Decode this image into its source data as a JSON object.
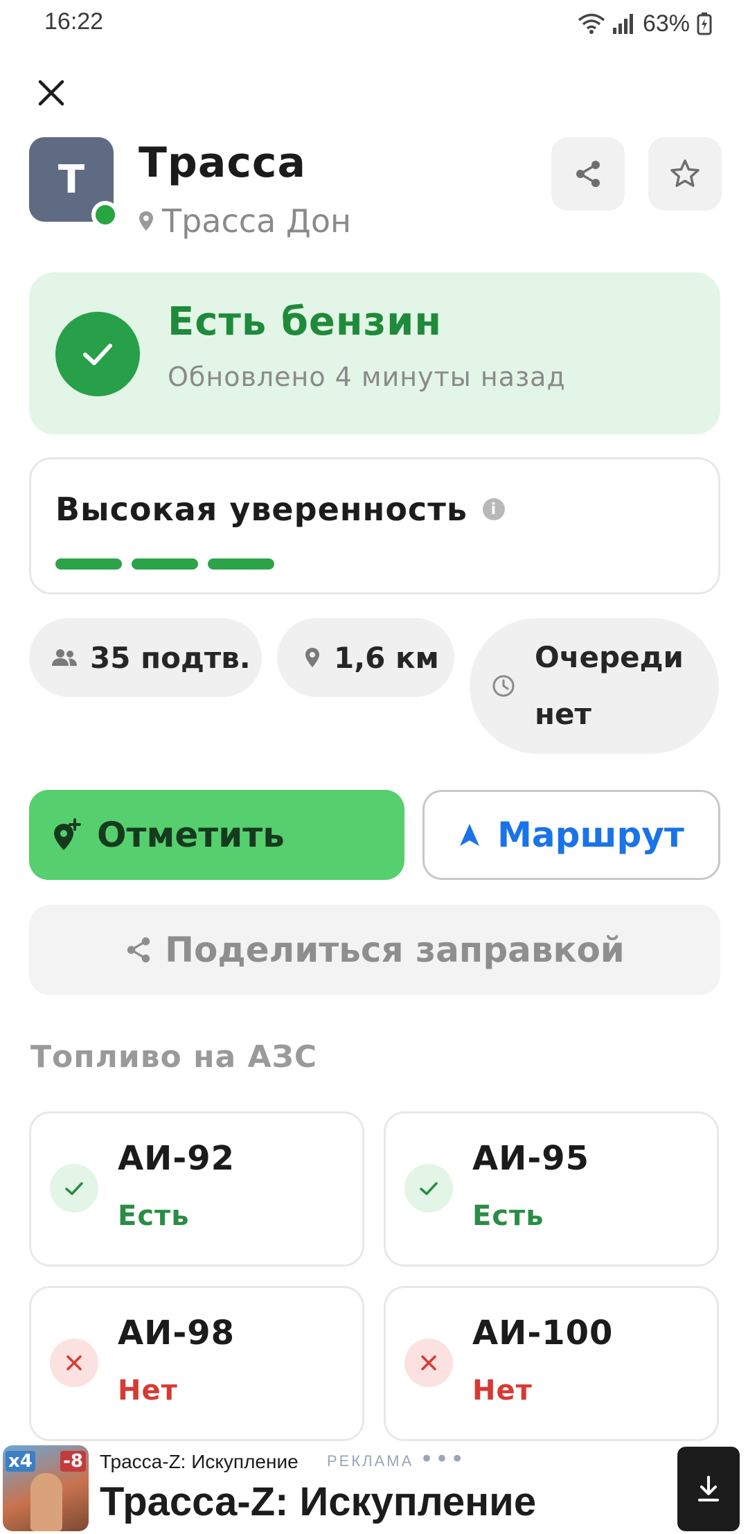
{
  "status_bar": {
    "time": "16:22",
    "battery": "63%",
    "icons": [
      "wifi-icon",
      "signal-icon",
      "battery-icon"
    ]
  },
  "station": {
    "avatar_letter": "Т",
    "name": "Трасса",
    "location": "Трасса Дон",
    "online": true
  },
  "fuel_status": {
    "title": "Есть бензин",
    "updated": "Обновлено 4 минуты назад",
    "color": "#27a049"
  },
  "confidence": {
    "title": "Высокая уверенность",
    "level": 3,
    "max_level": 3
  },
  "chips": {
    "confirmations": "35 подтв.",
    "distance": "1,6 км",
    "queue_line1": "Очереди",
    "queue_line2": "нет"
  },
  "actions": {
    "mark_label": "Отметить",
    "route_label": "Маршрут",
    "share_label": "Поделиться заправкой"
  },
  "fuel_section": {
    "title": "Топливо на АЗС",
    "items": [
      {
        "name": "АИ-92",
        "status": "Есть",
        "available": true
      },
      {
        "name": "АИ-95",
        "status": "Есть",
        "available": true
      },
      {
        "name": "АИ-98",
        "status": "Нет",
        "available": false
      },
      {
        "name": "АИ-100",
        "status": "Нет",
        "available": false
      }
    ]
  },
  "ad": {
    "small_title": "Трасса-Z: Искупление",
    "label": "РЕКЛАМА",
    "big_title": "Трасса-Z: Искупление",
    "badge_left": "x4",
    "badge_right": "-8"
  },
  "colors": {
    "accent_green": "#27a049",
    "button_green": "#56cf6e",
    "route_blue": "#1a73e8",
    "error_red": "#d63a33"
  }
}
